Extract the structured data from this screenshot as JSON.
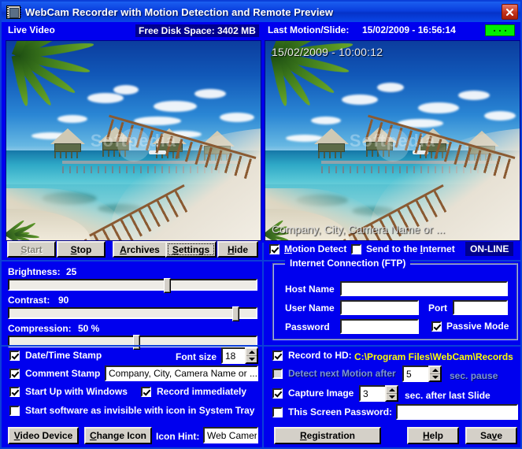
{
  "window": {
    "title": "WebCam Recorder with Motion Detection and Remote Preview",
    "icon": "film-camera-icon",
    "close_label": "close-icon"
  },
  "statusbar": {
    "live_video": "Live Video",
    "free_disk": "Free Disk Space: 3402 MB",
    "last_motion_label": "Last Motion/Slide:",
    "last_motion_value": "15/02/2009 - 16:56:14",
    "led": "recording-indicator"
  },
  "video": {
    "live_pane": {
      "name": "Live Video preview"
    },
    "last_pane": {
      "timestamp_overlay": "15/02/2009 - 10:00:12",
      "comment_overlay": "Company, City, Camera Name or ...",
      "watermark": "Softpedia"
    }
  },
  "toolbar": {
    "start": "Start",
    "start_disabled": true,
    "stop": "Stop",
    "archives": "Archives",
    "settings": "Settings",
    "settings_focused": true,
    "hide": "Hide",
    "motion_detect": "Motion Detect",
    "motion_detect_checked": true,
    "send_internet": "Send to the Internet",
    "send_internet_checked": false,
    "online_badge": "ON-LINE"
  },
  "sliders": [
    {
      "label": "Brightness:",
      "value": "25",
      "percent": 63
    },
    {
      "label": "Contrast:",
      "value": "90",
      "percent": 90
    },
    {
      "label": "Compression:",
      "value": "50 %",
      "percent": 50
    }
  ],
  "ftp": {
    "legend": "Internet Connection (FTP)",
    "host_name_label": "Host Name",
    "host_name_value": "",
    "user_name_label": "User Name",
    "user_name_value": "",
    "port_label": "Port",
    "port_value": "",
    "password_label": "Password",
    "password_value": "",
    "passive_mode_label": "Passive Mode",
    "passive_mode_checked": true
  },
  "left_options": {
    "datetime_stamp": "Date/Time Stamp",
    "datetime_stamp_checked": true,
    "font_size_label": "Font size",
    "font_size_value": "18",
    "comment_stamp": "Comment Stamp",
    "comment_stamp_checked": true,
    "comment_value": "Company, City, Camera Name or ...",
    "startup_windows": "Start Up with Windows",
    "startup_windows_checked": true,
    "record_immediately": "Record immediately",
    "record_immediately_checked": true,
    "invisible_tray": "Start software as invisible with icon in System Tray",
    "invisible_tray_checked": false,
    "video_device_button": "Video Device",
    "change_icon_button": "Change Icon",
    "icon_hint_label": "Icon Hint:",
    "icon_hint_value": "Web Camera"
  },
  "right_options": {
    "record_hd_label": "Record to HD:",
    "record_hd_checked": true,
    "record_hd_path": "C:\\Program Files\\WebCam\\Records",
    "detect_next_label": "Detect next Motion after",
    "detect_next_checked": false,
    "detect_next_disabled": true,
    "detect_next_value": "5",
    "detect_next_suffix": "sec. pause",
    "capture_image_label": "Capture Image",
    "capture_image_checked": true,
    "capture_image_value": "3",
    "capture_image_suffix": "sec. after last Slide",
    "screen_password_label": "This Screen Password:",
    "screen_password_checked": false,
    "screen_password_value": "",
    "registration_button": "Registration",
    "help_button": "Help",
    "save_button": "Save"
  },
  "colors": {
    "window_blue": "#0000ee",
    "title_blue": "#0a3ede",
    "accent_yellow": "#ffff00",
    "led_green": "#00ee00",
    "badge_navy": "#00008f",
    "face_gray": "#d4d0c8"
  }
}
